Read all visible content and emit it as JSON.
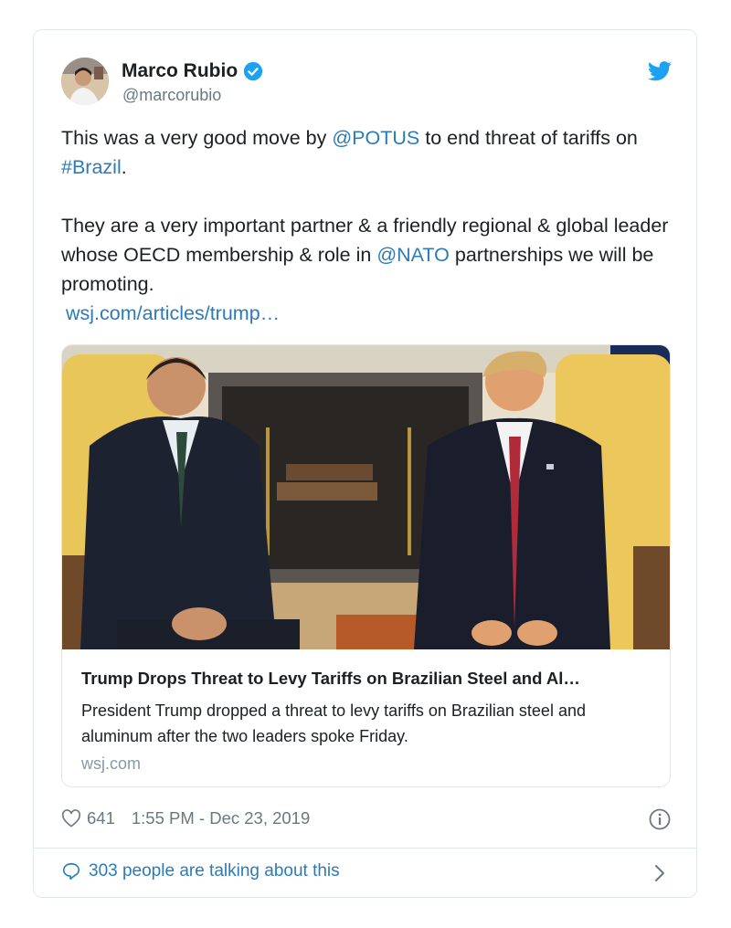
{
  "author": {
    "display_name": "Marco Rubio",
    "handle": "@marcorubio"
  },
  "tweet": {
    "line1_pre": "This was a very good move by ",
    "line1_mention": "@POTUS",
    "line1_post": " to end threat of tariffs on ",
    "line1_hashtag": "#Brazil",
    "line1_end": ".",
    "para2_pre": "They are a very important partner & a friendly regional & global leader whose OECD membership & role in ",
    "para2_mention": "@NATO",
    "para2_post": " partnerships we will be promoting.",
    "link": "wsj.com/articles/trump…"
  },
  "card": {
    "title": "Trump Drops Threat to Levy Tariffs on Brazilian Steel and Al…",
    "description": "President Trump dropped a threat to levy tariffs on Brazilian steel and aluminum after the two leaders spoke Friday.",
    "domain": "wsj.com"
  },
  "meta": {
    "likes": "641",
    "timestamp": "1:55 PM - Dec 23, 2019"
  },
  "footer": {
    "talking": "303 people are talking about this"
  },
  "colors": {
    "link": "#2b7bb9",
    "twitter_blue": "#1da1f2",
    "muted": "#697882"
  }
}
